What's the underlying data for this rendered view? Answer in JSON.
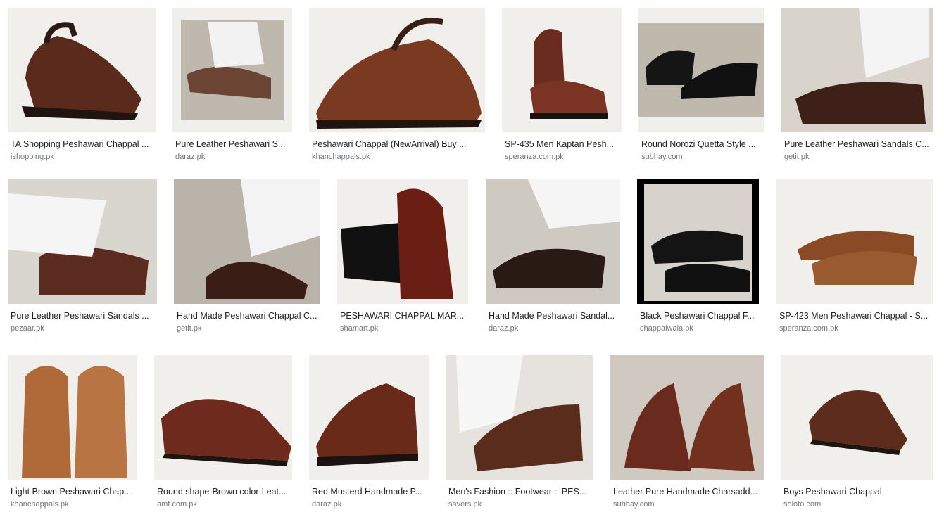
{
  "results": [
    {
      "title": "TA Shopping Peshawari Chappal ...",
      "source": "ishopping.pk",
      "shoe": "reddish-brown-chappal-icon",
      "color": "#5a2a1c"
    },
    {
      "title": "Pure Leather Peshawari S...",
      "source": "daraz.pk",
      "shoe": "brown-chappal-worn-icon",
      "color": "#6b4433"
    },
    {
      "title": "Peshawari Chappal (NewArrival) Buy ...",
      "source": "khanchappals.pk",
      "shoe": "reddish-brown-chappal-icon",
      "color": "#7a3a22"
    },
    {
      "title": "SP-435 Men Kaptan Pesh...",
      "source": "speranza.com.pk",
      "shoe": "brown-chappal-pair-icon",
      "color": "#6a2c1f"
    },
    {
      "title": "Round Norozi Quetta Style ...",
      "source": "subhay.com",
      "shoe": "black-chappal-pair-icon",
      "color": "#151515"
    },
    {
      "title": "Pure Leather Peshawari Sandals C...",
      "source": "getit.pk",
      "shoe": "dark-brown-chappal-worn-icon",
      "color": "#3e2018"
    },
    {
      "title": "Pure Leather Peshawari Sandals ...",
      "source": "pezaar.pk",
      "shoe": "brown-chappal-worn-icon",
      "color": "#5a2b1e"
    },
    {
      "title": "Hand Made Peshawari Chappal C...",
      "source": "getit.pk",
      "shoe": "dark-brown-chappal-worn-icon",
      "color": "#3a1e15"
    },
    {
      "title": "PESHAWARI CHAPPAL MAR...",
      "source": "shamart.pk",
      "shoe": "maroon-chappal-icon",
      "color": "#6b1e14"
    },
    {
      "title": "Hand Made Peshawari Sandal...",
      "source": "daraz.pk",
      "shoe": "black-chappal-worn-icon",
      "color": "#2a1a14"
    },
    {
      "title": "Black Peshawari Chappal F...",
      "source": "chappalwala.pk",
      "shoe": "black-chappal-worn-icon",
      "color": "#141414"
    },
    {
      "title": "SP-423 Men Peshawari Chappal - S...",
      "source": "speranza.com.pk",
      "shoe": "brown-chappal-pair-icon",
      "color": "#8a4a26"
    },
    {
      "title": "Light Brown Peshawari Chap...",
      "source": "khanchappals.pk",
      "shoe": "light-brown-chappal-pair-icon",
      "color": "#b06a3a"
    },
    {
      "title": "Round shape-Brown color-Leat...",
      "source": "amf.com.pk",
      "shoe": "reddish-brown-chappal-icon",
      "color": "#6e2a1c"
    },
    {
      "title": "Red Musterd Handmade P...",
      "source": "daraz.pk",
      "shoe": "reddish-brown-chappal-icon",
      "color": "#6a2a1a"
    },
    {
      "title": "Men's Fashion :: Footwear :: PES...",
      "source": "savers.pk",
      "shoe": "brown-chappal-worn-icon",
      "color": "#5a2c1c"
    },
    {
      "title": "Leather Pure Handmade Charsadd...",
      "source": "subhay.com",
      "shoe": "brown-chappal-pair-icon",
      "color": "#6a2a1e"
    },
    {
      "title": "Boys Peshawari Chappal",
      "source": "soloto.com",
      "shoe": "brown-chappal-icon",
      "color": "#5e2c1c"
    }
  ]
}
